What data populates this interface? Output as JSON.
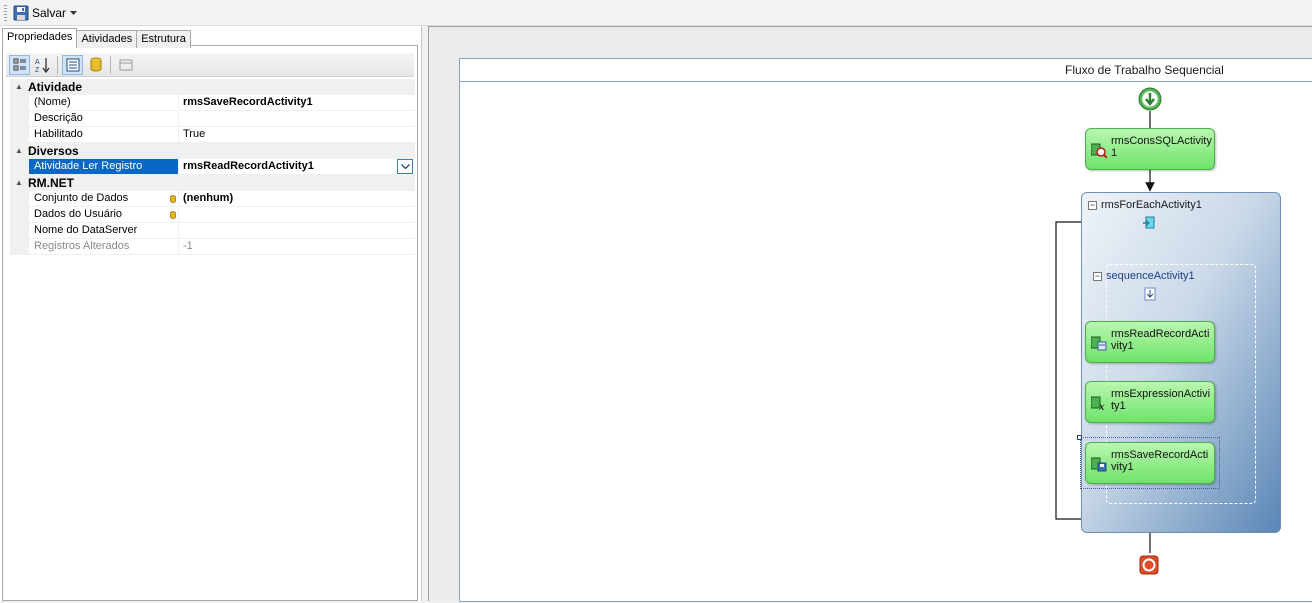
{
  "toolbar": {
    "save_label": "Salvar"
  },
  "tabs": [
    {
      "label": "Propriedades",
      "active": true
    },
    {
      "label": "Atividades",
      "active": false
    },
    {
      "label": "Estrutura",
      "active": false
    }
  ],
  "property_grid": {
    "categories": [
      {
        "label": "Atividade",
        "rows": [
          {
            "name": "(Nome)",
            "value": "rmsSaveRecordActivity1",
            "bold": true
          },
          {
            "name": "Descrição",
            "value": ""
          },
          {
            "name": "Habilitado",
            "value": "True"
          }
        ]
      },
      {
        "label": "Diversos",
        "rows": [
          {
            "name": "Atividade Ler Registro",
            "value": "rmsReadRecordActivity1",
            "bold": true,
            "selected": true
          }
        ]
      },
      {
        "label": "RM.NET",
        "rows": [
          {
            "name": "Conjunto de Dados",
            "value": "(nenhum)",
            "bold": true
          },
          {
            "name": "Dados do Usuário",
            "value": ""
          },
          {
            "name": "Nome do DataServer",
            "value": ""
          },
          {
            "name": "Registros Alterados",
            "value": "-1",
            "disabled": true
          }
        ]
      }
    ]
  },
  "designer": {
    "title": "Fluxo de Trabalho Sequencial",
    "activities": {
      "cons_sql": "rmsConsSQLActivity1",
      "for_each": "rmsForEachActivity1",
      "sequence": "sequenceActivity1",
      "read_record": "rmsReadRecordActivity1",
      "expression": "rmsExpressionActivity1",
      "save_record": "rmsSaveRecordActivity1"
    }
  },
  "colors": {
    "selection": "#0a67c4",
    "activity_green": "#6fe26a",
    "container_blue": "#5a86b6",
    "start_green": "#4caf50",
    "end_red": "#e04b2a"
  }
}
